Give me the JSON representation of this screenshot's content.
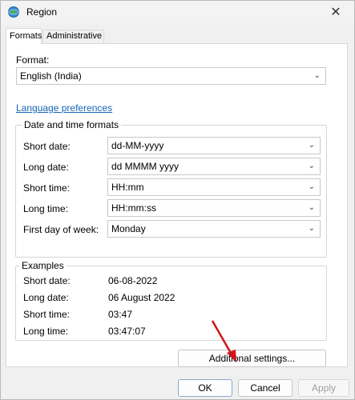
{
  "window": {
    "title": "Region",
    "close_glyph": "✕"
  },
  "tabs": [
    {
      "label": "Formats",
      "active": true
    },
    {
      "label": "Administrative",
      "active": false
    }
  ],
  "format": {
    "label": "Format:",
    "value": "English (India)"
  },
  "language_link": "Language preferences",
  "date_time": {
    "legend": "Date and time formats",
    "rows": [
      {
        "label": "Short date:",
        "value": "dd-MM-yyyy"
      },
      {
        "label": "Long date:",
        "value": "dd MMMM yyyy"
      },
      {
        "label": "Short time:",
        "value": "HH:mm"
      },
      {
        "label": "Long time:",
        "value": "HH:mm:ss"
      },
      {
        "label": "First day of week:",
        "value": "Monday"
      }
    ]
  },
  "examples": {
    "legend": "Examples",
    "rows": [
      {
        "label": "Short date:",
        "value": "06-08-2022"
      },
      {
        "label": "Long date:",
        "value": "06 August 2022"
      },
      {
        "label": "Short time:",
        "value": "03:47"
      },
      {
        "label": "Long time:",
        "value": "03:47:07"
      }
    ]
  },
  "buttons": {
    "additional": "Additional settings...",
    "ok": "OK",
    "cancel": "Cancel",
    "apply": "Apply"
  },
  "colors": {
    "link": "#1565b8",
    "annotation_arrow": "#d0131b"
  },
  "icons": {
    "app": "globe-icon",
    "chevron": "chevron-down-icon"
  }
}
